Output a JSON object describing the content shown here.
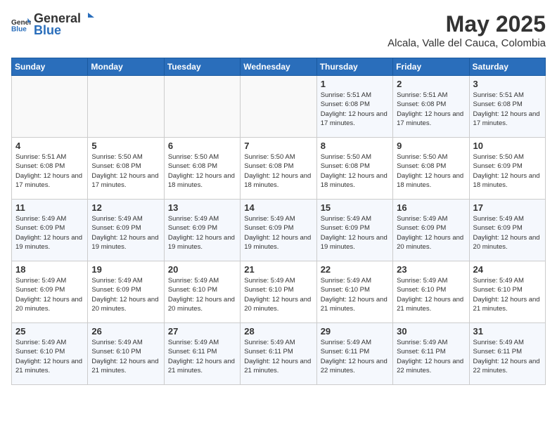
{
  "header": {
    "logo_general": "General",
    "logo_blue": "Blue",
    "month": "May 2025",
    "location": "Alcala, Valle del Cauca, Colombia"
  },
  "weekdays": [
    "Sunday",
    "Monday",
    "Tuesday",
    "Wednesday",
    "Thursday",
    "Friday",
    "Saturday"
  ],
  "weeks": [
    [
      {
        "day": "",
        "sunrise": "",
        "sunset": "",
        "daylight": ""
      },
      {
        "day": "",
        "sunrise": "",
        "sunset": "",
        "daylight": ""
      },
      {
        "day": "",
        "sunrise": "",
        "sunset": "",
        "daylight": ""
      },
      {
        "day": "",
        "sunrise": "",
        "sunset": "",
        "daylight": ""
      },
      {
        "day": "1",
        "sunrise": "5:51 AM",
        "sunset": "6:08 PM",
        "daylight": "12 hours and 17 minutes."
      },
      {
        "day": "2",
        "sunrise": "5:51 AM",
        "sunset": "6:08 PM",
        "daylight": "12 hours and 17 minutes."
      },
      {
        "day": "3",
        "sunrise": "5:51 AM",
        "sunset": "6:08 PM",
        "daylight": "12 hours and 17 minutes."
      }
    ],
    [
      {
        "day": "4",
        "sunrise": "5:51 AM",
        "sunset": "6:08 PM",
        "daylight": "12 hours and 17 minutes."
      },
      {
        "day": "5",
        "sunrise": "5:50 AM",
        "sunset": "6:08 PM",
        "daylight": "12 hours and 17 minutes."
      },
      {
        "day": "6",
        "sunrise": "5:50 AM",
        "sunset": "6:08 PM",
        "daylight": "12 hours and 18 minutes."
      },
      {
        "day": "7",
        "sunrise": "5:50 AM",
        "sunset": "6:08 PM",
        "daylight": "12 hours and 18 minutes."
      },
      {
        "day": "8",
        "sunrise": "5:50 AM",
        "sunset": "6:08 PM",
        "daylight": "12 hours and 18 minutes."
      },
      {
        "day": "9",
        "sunrise": "5:50 AM",
        "sunset": "6:08 PM",
        "daylight": "12 hours and 18 minutes."
      },
      {
        "day": "10",
        "sunrise": "5:50 AM",
        "sunset": "6:09 PM",
        "daylight": "12 hours and 18 minutes."
      }
    ],
    [
      {
        "day": "11",
        "sunrise": "5:49 AM",
        "sunset": "6:09 PM",
        "daylight": "12 hours and 19 minutes."
      },
      {
        "day": "12",
        "sunrise": "5:49 AM",
        "sunset": "6:09 PM",
        "daylight": "12 hours and 19 minutes."
      },
      {
        "day": "13",
        "sunrise": "5:49 AM",
        "sunset": "6:09 PM",
        "daylight": "12 hours and 19 minutes."
      },
      {
        "day": "14",
        "sunrise": "5:49 AM",
        "sunset": "6:09 PM",
        "daylight": "12 hours and 19 minutes."
      },
      {
        "day": "15",
        "sunrise": "5:49 AM",
        "sunset": "6:09 PM",
        "daylight": "12 hours and 19 minutes."
      },
      {
        "day": "16",
        "sunrise": "5:49 AM",
        "sunset": "6:09 PM",
        "daylight": "12 hours and 20 minutes."
      },
      {
        "day": "17",
        "sunrise": "5:49 AM",
        "sunset": "6:09 PM",
        "daylight": "12 hours and 20 minutes."
      }
    ],
    [
      {
        "day": "18",
        "sunrise": "5:49 AM",
        "sunset": "6:09 PM",
        "daylight": "12 hours and 20 minutes."
      },
      {
        "day": "19",
        "sunrise": "5:49 AM",
        "sunset": "6:09 PM",
        "daylight": "12 hours and 20 minutes."
      },
      {
        "day": "20",
        "sunrise": "5:49 AM",
        "sunset": "6:10 PM",
        "daylight": "12 hours and 20 minutes."
      },
      {
        "day": "21",
        "sunrise": "5:49 AM",
        "sunset": "6:10 PM",
        "daylight": "12 hours and 20 minutes."
      },
      {
        "day": "22",
        "sunrise": "5:49 AM",
        "sunset": "6:10 PM",
        "daylight": "12 hours and 21 minutes."
      },
      {
        "day": "23",
        "sunrise": "5:49 AM",
        "sunset": "6:10 PM",
        "daylight": "12 hours and 21 minutes."
      },
      {
        "day": "24",
        "sunrise": "5:49 AM",
        "sunset": "6:10 PM",
        "daylight": "12 hours and 21 minutes."
      }
    ],
    [
      {
        "day": "25",
        "sunrise": "5:49 AM",
        "sunset": "6:10 PM",
        "daylight": "12 hours and 21 minutes."
      },
      {
        "day": "26",
        "sunrise": "5:49 AM",
        "sunset": "6:10 PM",
        "daylight": "12 hours and 21 minutes."
      },
      {
        "day": "27",
        "sunrise": "5:49 AM",
        "sunset": "6:11 PM",
        "daylight": "12 hours and 21 minutes."
      },
      {
        "day": "28",
        "sunrise": "5:49 AM",
        "sunset": "6:11 PM",
        "daylight": "12 hours and 21 minutes."
      },
      {
        "day": "29",
        "sunrise": "5:49 AM",
        "sunset": "6:11 PM",
        "daylight": "12 hours and 22 minutes."
      },
      {
        "day": "30",
        "sunrise": "5:49 AM",
        "sunset": "6:11 PM",
        "daylight": "12 hours and 22 minutes."
      },
      {
        "day": "31",
        "sunrise": "5:49 AM",
        "sunset": "6:11 PM",
        "daylight": "12 hours and 22 minutes."
      }
    ]
  ],
  "labels": {
    "sunrise": "Sunrise:",
    "sunset": "Sunset:",
    "daylight": "Daylight:"
  }
}
